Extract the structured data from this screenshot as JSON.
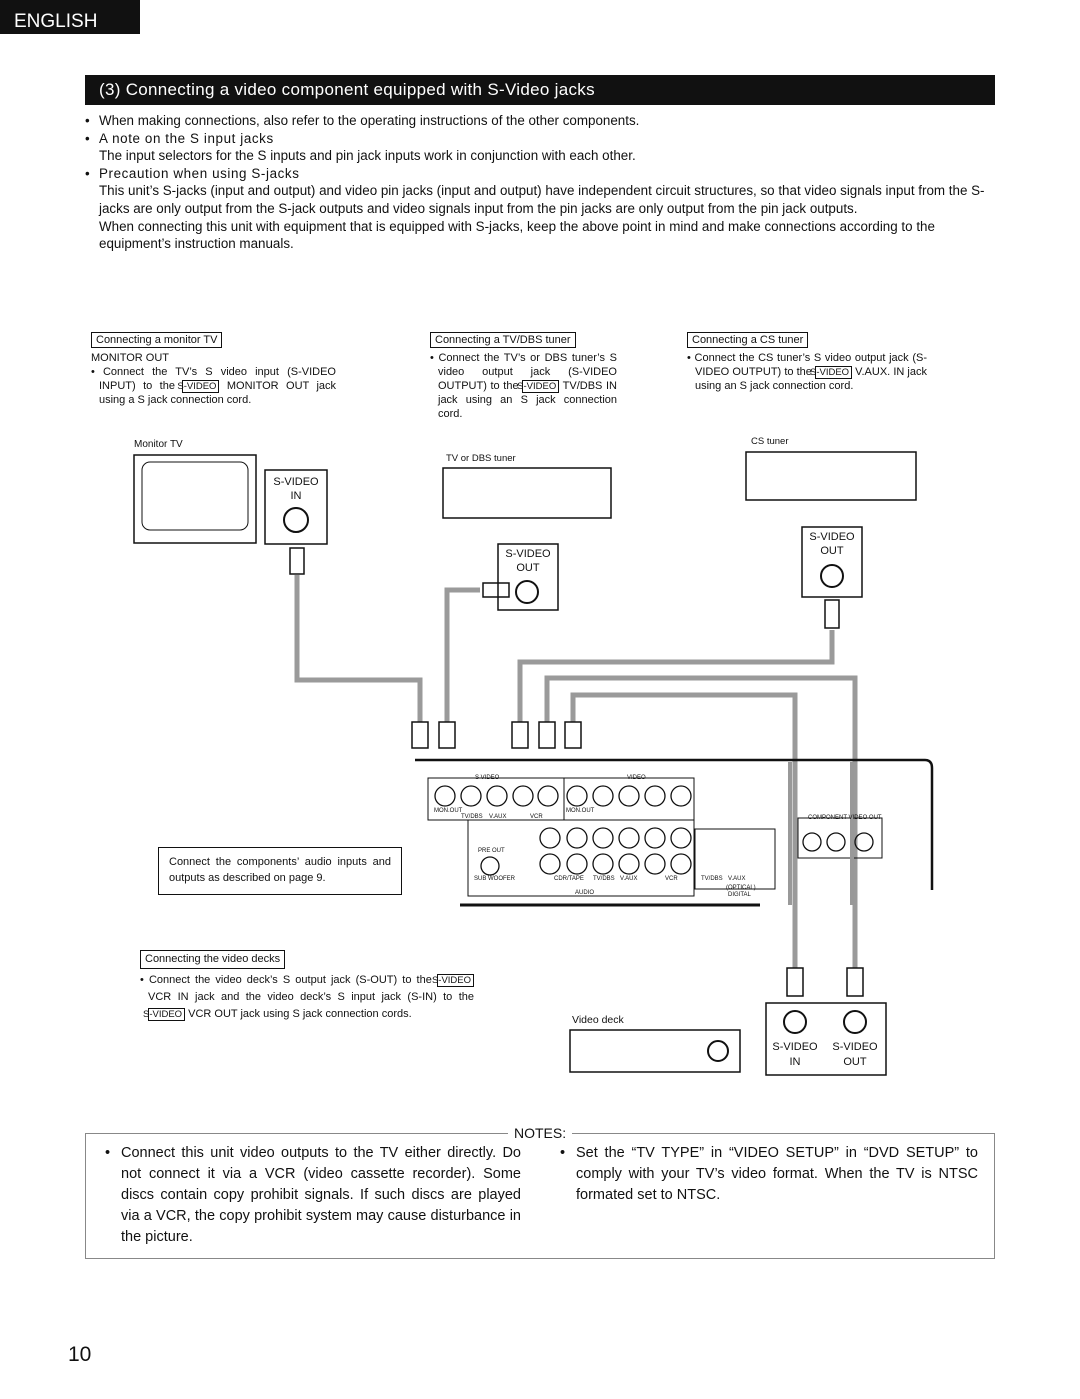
{
  "lang_tab": "ENGLISH",
  "header": "(3) Connecting a video component equipped with S-Video jacks",
  "intro": {
    "b1": "When making connections, also refer to the operating instructions of the other components.",
    "b2": "A note on the S input jacks",
    "p2": "The input selectors for the S inputs and pin jack inputs work in conjunction with each other.",
    "b3": "Precaution when using S-jacks",
    "p3a": "This unit’s S-jacks (input and output) and video pin jacks (input and output) have independent circuit structures, so that video signals input  from the S-jacks are only output from the S-jack outputs and video signals input from the pin jacks are only output from the pin jack outputs.",
    "p3b": "When connecting this unit with equipment that is equipped with S-jacks, keep the above point in mind and make connections according to the equipment’s instruction manuals."
  },
  "sv": "S-VIDEO",
  "monitor": {
    "label": "Connecting a monitor TV",
    "sub": "MONITOR OUT",
    "t1": "• Connect the TV’s S video input (S-VIDEO INPUT) to the",
    "t2": "MONITOR OUT jack using a S jack connection cord."
  },
  "tvdbs": {
    "label": "Connecting a TV/DBS tuner",
    "t1": "• Connect the TV’s or DBS tuner’s S video output jack (S-VIDEO OUTPUT) to the",
    "t2": "TV/DBS IN jack using an S jack connection cord."
  },
  "cs": {
    "label": "Connecting a CS tuner",
    "t1": "• Connect the CS tuner’s S video output jack (S-VIDEO OUTPUT) to the",
    "t2": "V.AUX. IN jack using an S jack connection cord."
  },
  "decks": {
    "label": "Connecting the video decks",
    "t1": "• Connect the video deck’s S output jack (S-OUT) to the",
    "t2": "VCR IN jack and the video deck’s S input jack (S-IN) to the",
    "t3": "VCR OUT jack using S jack connection cords."
  },
  "audio_note": "Connect the components’ audio inputs and outputs as described on page 9.",
  "diagram": {
    "monitor_tv": "Monitor TV",
    "tv_dbs_tuner": "TV or DBS tuner",
    "cs_tuner": "CS tuner",
    "video_deck": "Video deck",
    "svideo": "S-VIDEO",
    "in": "IN",
    "out": "OUT",
    "panel": {
      "s_video": "S VIDEO",
      "video": "VIDEO",
      "mon_out": "MON.OUT",
      "tv_dbs": "TV/DBS",
      "v_aux": "V.AUX",
      "vcr": "VCR",
      "pre_out": "PRE OUT",
      "sub_woofer": "SUB WOOFER",
      "cdr_tape": "CDR/TAPE",
      "audio": "AUDIO",
      "optical": "(OPTICAL)",
      "digital": "DIGITAL",
      "component": "COMPONENT VIDEO OUT",
      "y": "Y",
      "cb": "Cb",
      "cr": "Cr",
      "l": "L",
      "r": "R"
    }
  },
  "notes": {
    "title": "NOTES:",
    "n1": "Connect this unit video outputs to the TV either directly. Do not connect it via a VCR (video cassette recorder). Some discs contain copy prohibit signals. If such discs are played via a VCR, the copy prohibit system may cause disturbance in the picture.",
    "n2": "Set the “TV TYPE” in “VIDEO SETUP” in “DVD SETUP” to comply with your TV’s video format. When the TV is NTSC formated set to NTSC."
  },
  "page_number": "10"
}
